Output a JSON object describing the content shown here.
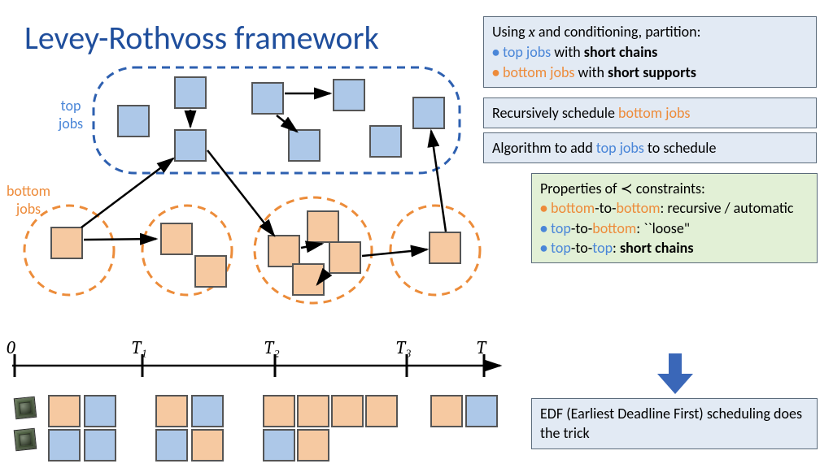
{
  "title": "Levey-Rothvoss framework",
  "side_labels": {
    "top_jobs": "top jobs",
    "bottom_jobs": "bottom jobs"
  },
  "timeline": {
    "ticks": [
      "0",
      "T₁",
      "T₂",
      "T₃",
      "T"
    ]
  },
  "panel1": {
    "intro_a": "Using ",
    "intro_var": "x",
    "intro_b": " and conditioning, partition:",
    "item1_a": "top jobs",
    "item1_b": " with ",
    "item1_c": "short chains",
    "item2_a": "bottom jobs",
    "item2_b": " with ",
    "item2_c": "short supports"
  },
  "panel2_a": "Recursively schedule ",
  "panel2_b": "bottom jobs",
  "panel3_a": "Algorithm to add ",
  "panel3_b": "top jobs",
  "panel3_c": " to schedule",
  "panel4": {
    "header": "Properties of ≺ constraints:",
    "i1_a": "bottom",
    "i1_b": "-to-",
    "i1_c": "bottom",
    "i1_d": ": recursive / automatic",
    "i2_a": "top",
    "i2_b": "-to-",
    "i2_c": "bottom",
    "i2_d": ": ``loose\"",
    "i3_a": "top",
    "i3_b": "-to-",
    "i3_c": "top",
    "i3_d": ": ",
    "i3_e": "short chains"
  },
  "panel5": "EDF (Earliest Deadline First) scheduling does the trick",
  "colors": {
    "top_blue": "#4a86d8",
    "bottom_orange": "#ed8b3a",
    "job_blue": "#adc8e8",
    "job_orange": "#f6c9a1"
  }
}
